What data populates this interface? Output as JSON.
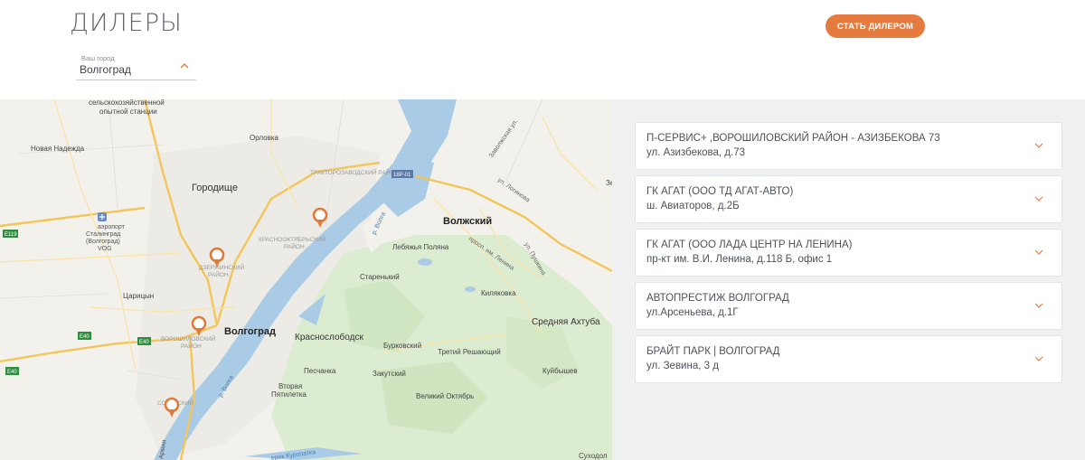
{
  "header": {
    "title": "ДИЛЕРЫ",
    "cta_label": "СТАТЬ ДИЛЕРОМ",
    "accent_color": "#e57b3e"
  },
  "city_select": {
    "label": "Ваш город",
    "value": "Волгоград"
  },
  "map": {
    "labels": {
      "station1": "сельскохозяйственной",
      "station2": "опытной станции",
      "orlovka": "Орловка",
      "novaya": "Новая Надежда",
      "gorodishche": "Городище",
      "traktor": "ТРАКТОРОЗАВОДСКИЙ РАЙОН",
      "zavolzh": "Заволжская ул.",
      "volzhsky": "Волжский",
      "krasnooktyabr1": "КРАСНООКТЯБРЬСКИЙ",
      "krasnooktyabr2": "РАЙОН",
      "airport1": "аэропорт",
      "airport2": "Сталинград",
      "airport3": "(Волгоград)",
      "airport4": "VOG",
      "dzerzh1": "ДЗЕРЖИНСКИЙ",
      "dzerzh2": "РАЙОН",
      "tsaritsyn": "Царицын",
      "volgograd": "Волгоград",
      "voroshil1": "ВОРОШИЛОВСКИЙ",
      "voroshil2": "РАЙОН",
      "krasnoslobodsk": "Краснослободск",
      "lebyazhya": "Лебяжья Поляна",
      "starenky": "Старенький",
      "kilyakovka": "Киляковка",
      "akhtuba": "Средняя Ахтуба",
      "burkovsky": "Бурковский",
      "treti": "Третий Решающий",
      "kuybyshev": "Куйбышев",
      "pesчanka": "Песчанка",
      "zakutsky": "Закутский",
      "vtoraya1": "Вторая",
      "vtoraya2": "Пятилетка",
      "velikiy": "Великий Октябрь",
      "sovetsky": "СОВЕТСКИЙ",
      "sukhodol": "Суходол",
      "prLenina": "просп. им. Ленина",
      "ulLogvinova": "ул. Логинова",
      "ulPushkina": "ул. Пушкина",
      "rVolga1": "р. Волга",
      "rVolga2": "р. Волга",
      "kuropatka": "ерик Куропатка",
      "armii": "Армии",
      "e119": "E119",
      "e40a": "E40",
      "e40b": "E40",
      "e40c": "E40",
      "r18": "18Р-01",
      "se": "Зе"
    }
  },
  "dealers": [
    {
      "name": "П-СЕРВИС+ ,ВОРОШИЛОВСКИЙ РАЙОН - АЗИЗБЕКОВА 73",
      "address": "ул. Азизбекова, д.73"
    },
    {
      "name": "ГК АГАТ (ООО ТД АГАТ-АВТО)",
      "address": "ш. Авиаторов, д.2Б"
    },
    {
      "name": "ГК АГАТ (ООО ЛАДА ЦЕНТР НА ЛЕНИНА)",
      "address": "пр-кт им. В.И. Ленина, д.118 Б, офис 1"
    },
    {
      "name": "АВТОПРЕСТИЖ ВОЛГОГРАД",
      "address": "ул.Арсеньева, д.1Г"
    },
    {
      "name": "БРАЙТ ПАРК | ВОЛГОГРАД",
      "address": "ул. Зевина, 3 д"
    }
  ]
}
